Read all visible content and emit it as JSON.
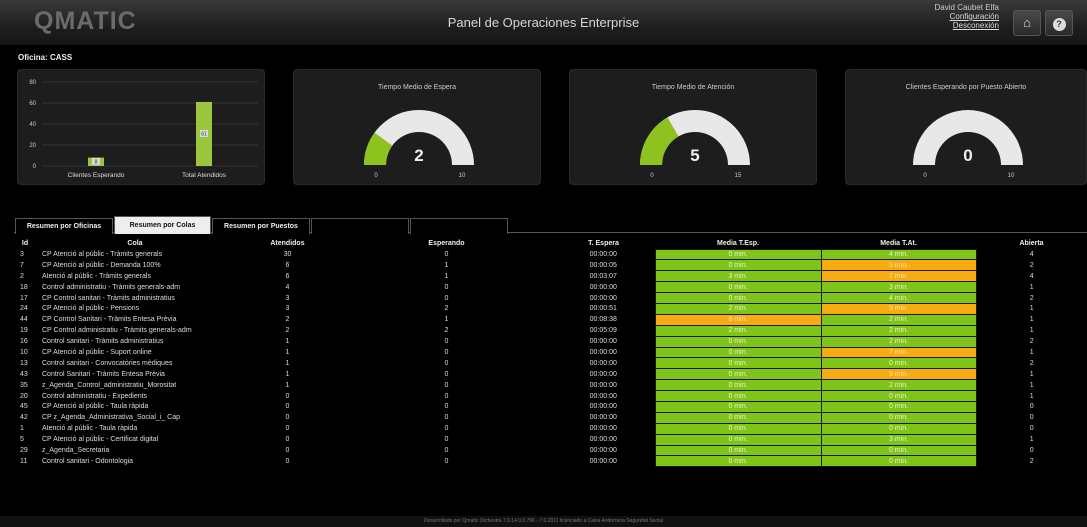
{
  "header": {
    "logo": "QMATIC",
    "title": "Panel de Operaciones Enterprise",
    "user_name": "David Caubet Elfa",
    "config_link": "Configuración",
    "logout_link": "Desconexión",
    "home_icon": "home-icon",
    "help_icon": "help-icon"
  },
  "office": "Oficina: CASS",
  "chart_data": {
    "type": "bar",
    "categories": [
      "Clientes Esperando",
      "Total Atendidos"
    ],
    "values": [
      8,
      61
    ],
    "ylim": [
      0,
      80
    ],
    "yticks": [
      0,
      20,
      40,
      60,
      80
    ],
    "color": "#9bc53d",
    "grid": true
  },
  "gauges": [
    {
      "title": "Tiempo Medio de Espera",
      "value": 2,
      "min": 0,
      "max": 10,
      "min_label": "0",
      "max_label": "10",
      "value_label": "2"
    },
    {
      "title": "Tiempo Medio de Atención",
      "value": 5,
      "min": 0,
      "max": 15,
      "min_label": "0",
      "max_label": "15",
      "value_label": "5"
    },
    {
      "title": "Clientes Esperando por Puesto Abierto",
      "value": 0,
      "min": 0,
      "max": 10,
      "min_label": "0",
      "max_label": "10",
      "value_label": "0"
    }
  ],
  "colors": {
    "green": "#7fc418",
    "orange": "#f8ab10",
    "gauge_fill": "#8dc21f",
    "gauge_track": "#e8e8e8"
  },
  "tabs": [
    "Resumen por Oficinas",
    "Resumen por Colas",
    "Resumen por Puestos",
    "",
    ""
  ],
  "active_tab": 1,
  "table": {
    "headers": [
      "Id",
      "Cola",
      "Atendidos",
      "Esperando",
      "T. Espera",
      "Media T.Esp.",
      "Media T.At.",
      "Abierta"
    ],
    "rows": [
      [
        "3",
        "CP Atenció al públic - Tràmits generals",
        "30",
        "0",
        "00:00:00",
        "0 min.",
        "4 min.",
        "4"
      ],
      [
        "7",
        "CP Atenció al públic - Demanda 100%",
        "6",
        "1",
        "00:00:05",
        "0 min.",
        "5 min.",
        "2"
      ],
      [
        "2",
        "Atenció al públic - Tràmits generals",
        "6",
        "1",
        "00:03:07",
        "3 min.",
        "7 min.",
        "4"
      ],
      [
        "18",
        "Control administratiu - Tràmits generals-adm",
        "4",
        "0",
        "00:00:00",
        "0 min.",
        "3 min.",
        "1"
      ],
      [
        "17",
        "CP Control sanitari - Tràmits administratius",
        "3",
        "0",
        "00:00:00",
        "0 min.",
        "4 min.",
        "2"
      ],
      [
        "24",
        "CP Atenció al públic - Pensions",
        "3",
        "2",
        "00:00:51",
        "2 min.",
        "9 min.",
        "1"
      ],
      [
        "44",
        "CP Control Sanitari - Tràmits Entesa Prèvia",
        "2",
        "1",
        "00:08:38",
        "6 min.",
        "2 min.",
        "1"
      ],
      [
        "19",
        "CP Control administratiu - Tràmits generals-adm",
        "2",
        "2",
        "00:05:09",
        "2 min.",
        "2 min.",
        "1"
      ],
      [
        "16",
        "Control sanitari - Tràmits administratius",
        "1",
        "0",
        "00:00:00",
        "0 min.",
        "2 min.",
        "2"
      ],
      [
        "10",
        "CP Atenció al públic - Suport online",
        "1",
        "0",
        "00:00:00",
        "0 min.",
        "7 min.",
        "1"
      ],
      [
        "13",
        "Control sanitari - Convocatòries mèdiques",
        "1",
        "0",
        "00:00:00",
        "0 min.",
        "0 min.",
        "2"
      ],
      [
        "43",
        "Control Sanitari - Tràmits Entesa Prèvia",
        "1",
        "0",
        "00:00:00",
        "0 min.",
        "5 min.",
        "1"
      ],
      [
        "35",
        "z_Agenda_Control_administratiu_Morositat",
        "1",
        "0",
        "00:00:00",
        "0 min.",
        "2 min.",
        "1"
      ],
      [
        "20",
        "Control administratiu - Expedients",
        "0",
        "0",
        "00:00:00",
        "0 min.",
        "0 min.",
        "1"
      ],
      [
        "45",
        "CP Atenció al públic - Taula ràpida",
        "0",
        "0",
        "00:00:00",
        "0 min.",
        "0 min.",
        "0"
      ],
      [
        "42",
        "CP z_Agenda_Administrativa_Social_i_ Cap",
        "0",
        "0",
        "00:00:00",
        "0 min.",
        "0 min.",
        "0"
      ],
      [
        "1",
        "Atenció al públic - Taula ràpida",
        "0",
        "0",
        "00:00:00",
        "0 min.",
        "0 min.",
        "0"
      ],
      [
        "5",
        "CP Atenció al públic - Certificat digital",
        "0",
        "0",
        "00:00:00",
        "0 min.",
        "3 min.",
        "1"
      ],
      [
        "29",
        "z_Agenda_Secretaria",
        "0",
        "0",
        "00:00:00",
        "0 min.",
        "0 min.",
        "0"
      ],
      [
        "11",
        "Control sanitari - Odontologia",
        "0",
        "0",
        "00:00:00",
        "0 min.",
        "0 min.",
        "2"
      ]
    ],
    "wait_colors": [
      "green",
      "green",
      "green",
      "green",
      "green",
      "green",
      "orange",
      "green",
      "green",
      "green",
      "green",
      "green",
      "green",
      "green",
      "green",
      "green",
      "green",
      "green",
      "green",
      "green"
    ],
    "attend_colors": [
      "green",
      "orange",
      "orange",
      "green",
      "green",
      "orange",
      "green",
      "green",
      "green",
      "orange",
      "green",
      "orange",
      "green",
      "green",
      "green",
      "green",
      "green",
      "green",
      "green",
      "green"
    ]
  },
  "footer": "Desarrollado por Qmatic Orchestra 7.0.14.0.0.796 - 7.0.2011 licenciado a Caixa Andorrana Seguretat Social"
}
